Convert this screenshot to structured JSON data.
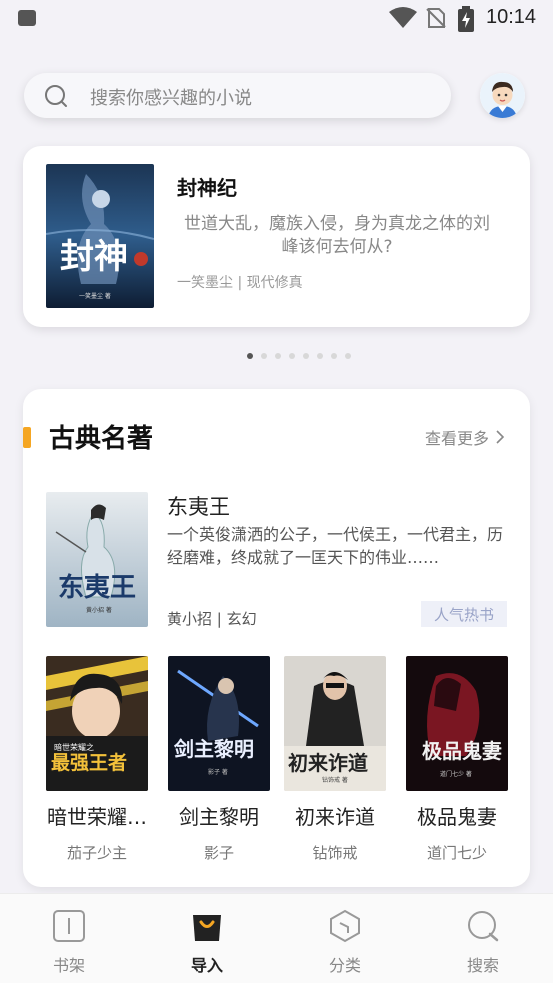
{
  "status_bar": {
    "time": "10:14"
  },
  "search": {
    "placeholder": "搜索你感兴趣的小说"
  },
  "banner": {
    "title": "封神纪",
    "description": "世道大乱，魔族入侵，身为真龙之体的刘峰该何去何从?",
    "meta": "一笑墨尘 | 现代修真",
    "cover_text": "封神",
    "cover_author": "一笑墨尘 著",
    "page_count": 8,
    "active_page": 0
  },
  "section": {
    "title": "古典名著",
    "see_more": "查看更多",
    "accent_color": "#f5a623",
    "featured": {
      "title": "东夷王",
      "description": "一个英俊潇洒的公子，一代侯王，一代君主，历经磨难，终成就了一匡天下的伟业……",
      "meta": "黄小招 | 玄幻",
      "tag": "人气热书",
      "cover_text": "东夷王",
      "cover_author": "黄小招 著"
    },
    "books": [
      {
        "title": "暗世荣耀…",
        "author": "茄子少主",
        "cover_text": "最强王者",
        "cover_sub": "暗世荣耀之"
      },
      {
        "title": "剑主黎明",
        "author": "影子",
        "cover_text": "剑主黎明",
        "cover_sub": "影子 著"
      },
      {
        "title": "初来诈道",
        "author": "钻饰戒",
        "cover_text": "初来诈道",
        "cover_sub": "钻饰戒 著"
      },
      {
        "title": "极品鬼妻",
        "author": "道门七少",
        "cover_text": "极品鬼妻",
        "cover_sub": "道门七少 著"
      }
    ]
  },
  "bottom_nav": {
    "items": [
      {
        "label": "书架",
        "icon": "bookshelf-icon",
        "active": false
      },
      {
        "label": "导入",
        "icon": "import-bag-icon",
        "active": true
      },
      {
        "label": "分类",
        "icon": "category-hexagon-icon",
        "active": false
      },
      {
        "label": "搜索",
        "icon": "search-circle-icon",
        "active": false
      }
    ]
  }
}
